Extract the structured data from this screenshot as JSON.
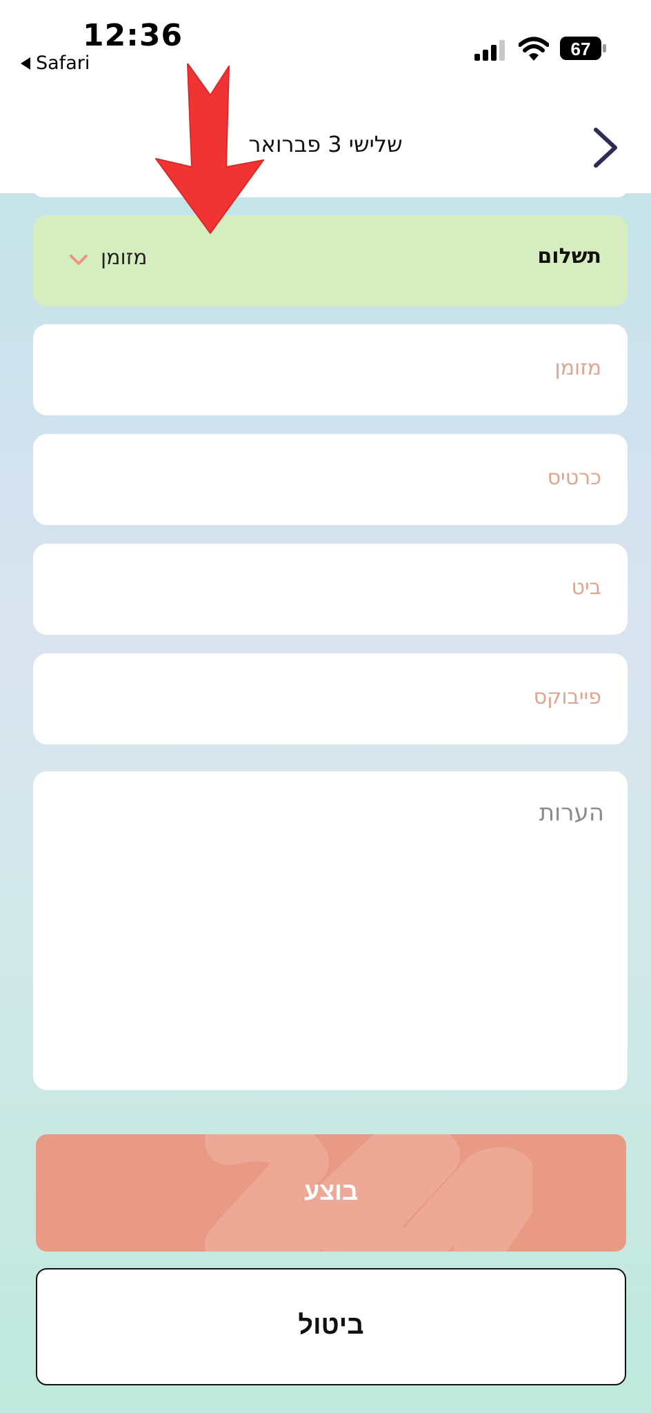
{
  "status_bar": {
    "time": "12:36",
    "back_app": "Safari",
    "battery": "67"
  },
  "header": {
    "title": "שלישי 3 פברואר"
  },
  "payment": {
    "label": "תשלום",
    "value": "מזומן"
  },
  "fields": [
    {
      "placeholder": "מזומן"
    },
    {
      "placeholder": "כרטיס"
    },
    {
      "placeholder": "ביט"
    },
    {
      "placeholder": "פייבוקס"
    }
  ],
  "notes": {
    "placeholder": "הערות"
  },
  "actions": {
    "done_label": "בוצע",
    "cancel_label": "ביטול"
  },
  "colors": {
    "accent": "#e99a84",
    "payment_bg": "#d6edbf",
    "placeholder": "#e0a492",
    "annotation_arrow": "#f03434"
  }
}
